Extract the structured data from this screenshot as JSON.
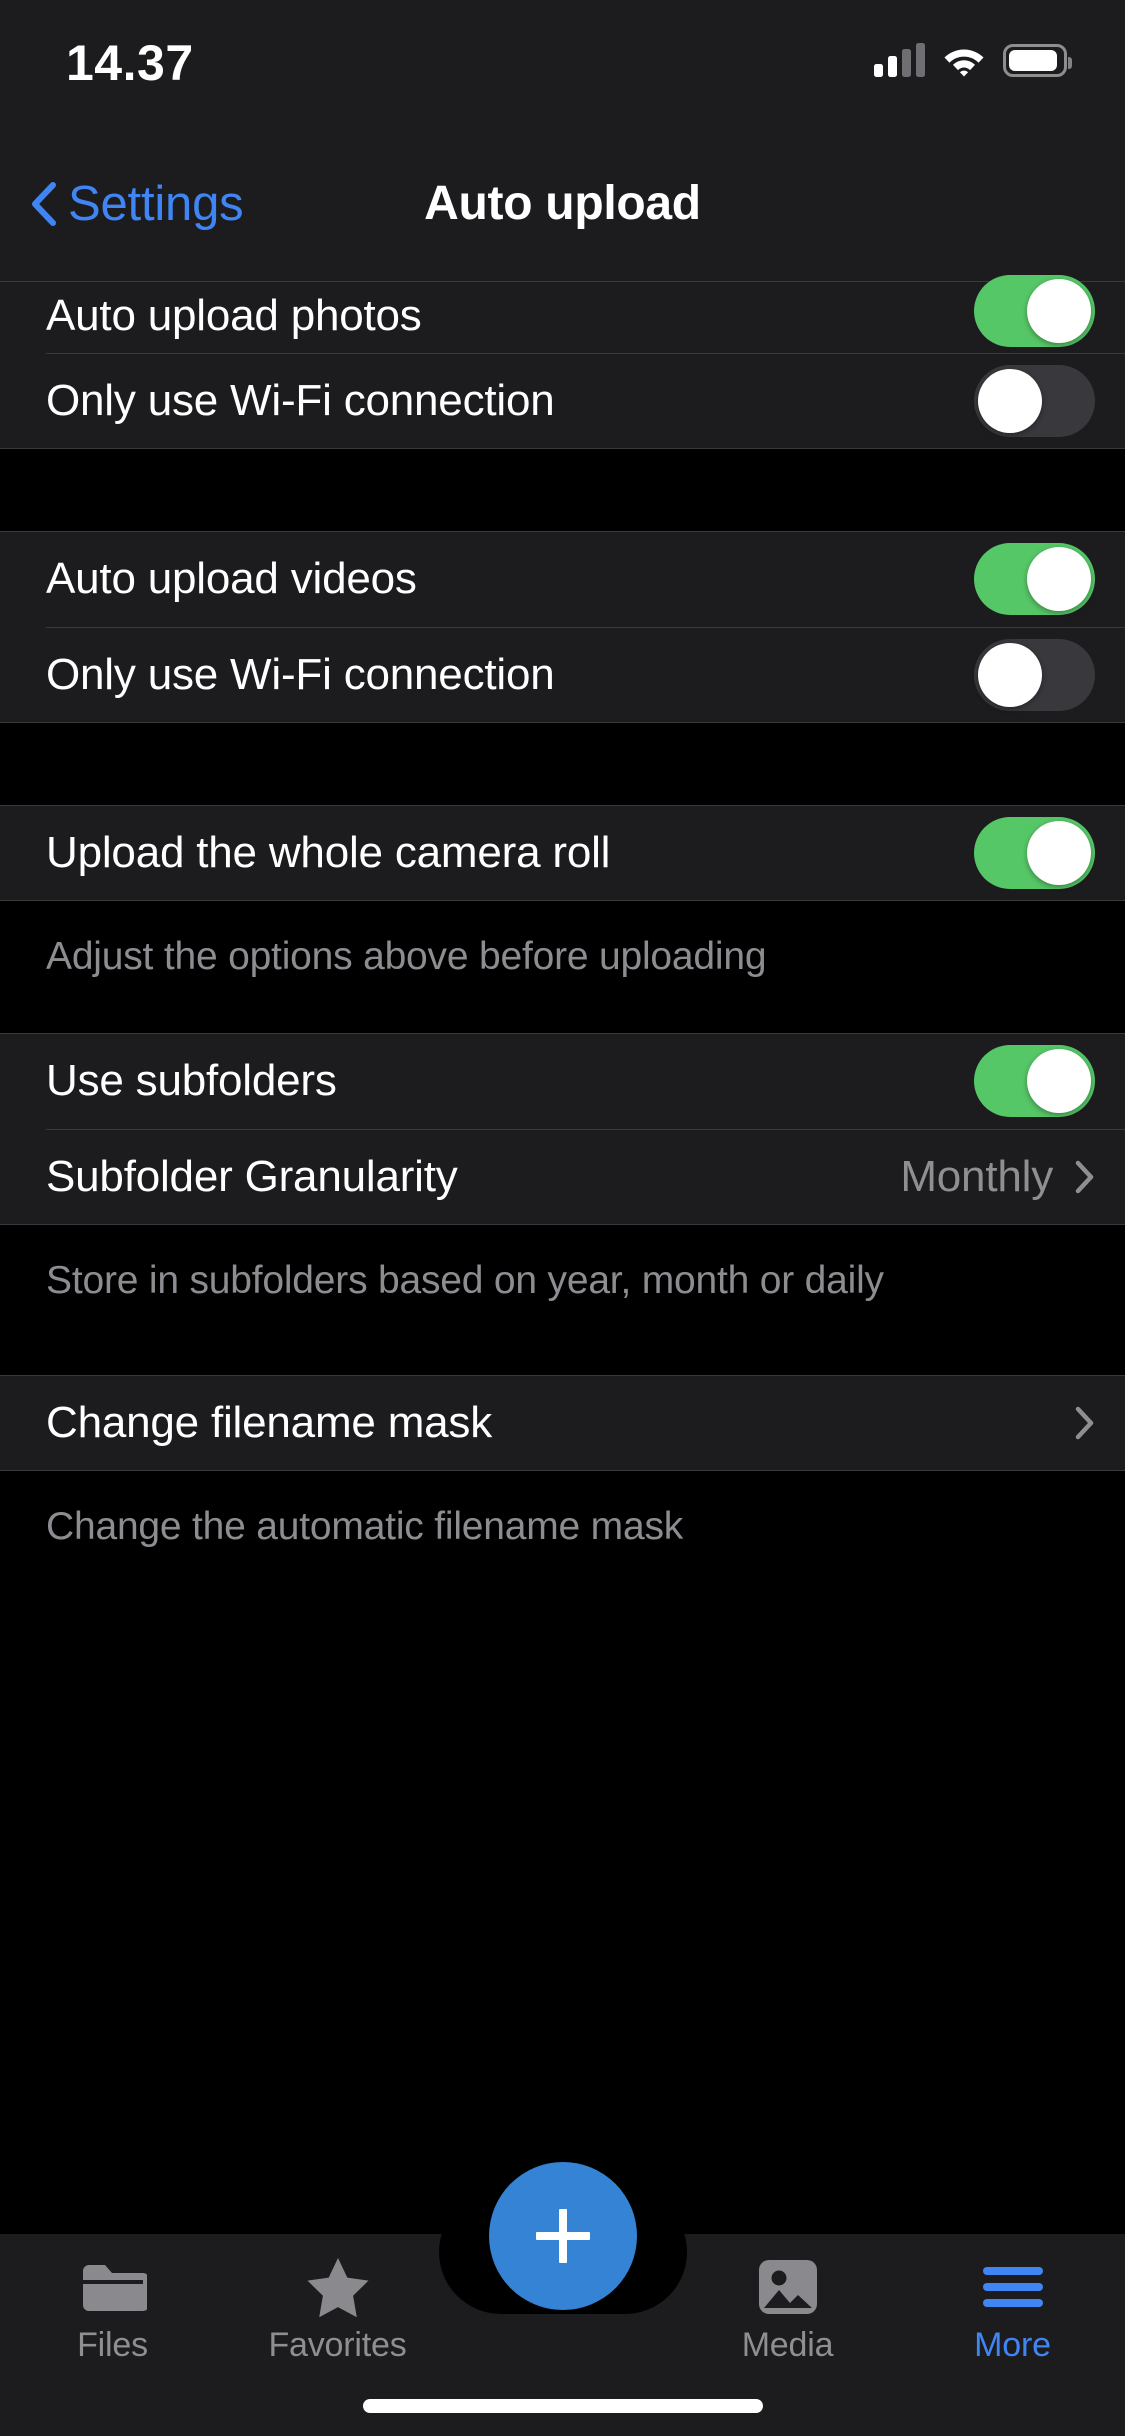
{
  "status_bar": {
    "time": "14.37",
    "signal_icon": "cellular-signal-icon",
    "wifi_icon": "wifi-icon",
    "battery_icon": "battery-icon"
  },
  "nav": {
    "back_label": "Settings",
    "back_icon": "chevron-left-icon",
    "title": "Auto upload"
  },
  "colors": {
    "accent_blue": "#3F86F4",
    "toggle_on": "#56C767",
    "toggle_off": "#39393D",
    "row_bg": "#1C1C1E",
    "page_bg": "#000000",
    "secondary_text": "#8E8E93",
    "fab_blue": "#3583D4"
  },
  "sections": [
    {
      "rows": [
        {
          "label": "Auto upload photos",
          "type": "toggle",
          "value": "on",
          "clipped": true
        },
        {
          "label": "Only use Wi-Fi connection",
          "type": "toggle",
          "value": "off"
        }
      ],
      "footer": ""
    },
    {
      "rows": [
        {
          "label": "Auto upload videos",
          "type": "toggle",
          "value": "on"
        },
        {
          "label": "Only use Wi-Fi connection",
          "type": "toggle",
          "value": "off"
        }
      ],
      "footer": ""
    },
    {
      "rows": [
        {
          "label": "Upload the whole camera roll",
          "type": "toggle",
          "value": "on"
        }
      ],
      "footer": "Adjust the options above before uploading"
    },
    {
      "rows": [
        {
          "label": "Use subfolders",
          "type": "toggle",
          "value": "on"
        },
        {
          "label": "Subfolder Granularity",
          "type": "disclosure",
          "value": "Monthly"
        }
      ],
      "footer": "Store in subfolders based on year, month or daily"
    },
    {
      "rows": [
        {
          "label": "Change filename mask",
          "type": "disclosure",
          "value": ""
        }
      ],
      "footer": "Change the automatic filename mask"
    }
  ],
  "tab_bar": {
    "tabs": [
      {
        "label": "Files",
        "icon": "folder-icon",
        "active": false
      },
      {
        "label": "Favorites",
        "icon": "star-icon",
        "active": false
      },
      {
        "label": "Media",
        "icon": "image-icon",
        "active": false
      },
      {
        "label": "More",
        "icon": "hamburger-menu-icon",
        "active": true
      }
    ],
    "fab": {
      "icon": "plus-icon",
      "label": "+"
    }
  }
}
